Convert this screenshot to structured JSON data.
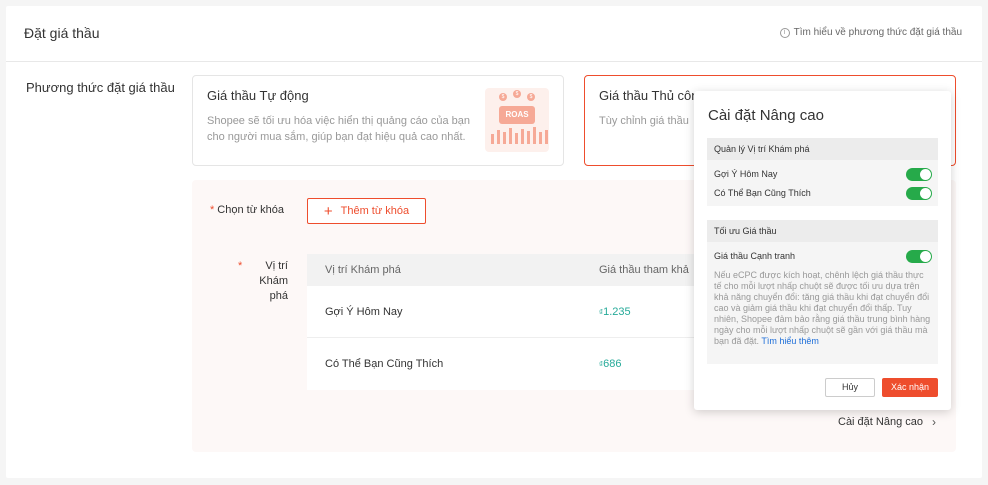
{
  "header": {
    "title": "Đặt giá thầu",
    "learn_link": "Tìm hiểu về phương thức đặt giá thầu"
  },
  "bid_method": {
    "label": "Phương thức đặt giá thầu",
    "auto": {
      "title": "Giá thầu Tự động",
      "desc": "Shopee sẽ tối ưu hóa việc hiển thị quảng cáo của bạn cho người mua sắm, giúp bạn đạt hiệu quả cao nhất.",
      "badge": "ROAS",
      "coin_symbol": "$"
    },
    "manual": {
      "title": "Giá thầu Thủ công",
      "desc": "Tùy chỉnh giá thầu"
    }
  },
  "keywords": {
    "label": "Chọn từ khóa",
    "required_mark": "*",
    "add_button": "Thêm từ khóa",
    "plus_glyph": "+"
  },
  "placement": {
    "label": "Vị trí Khám phá",
    "required_mark": "*",
    "columns": [
      "Vị trí Khám phá",
      "Giá thầu tham khả"
    ],
    "rows": [
      {
        "name": "Gợi Ý Hôm Nay",
        "currency": "₫",
        "bid": "1.235"
      },
      {
        "name": "Có Thể Bạn Cũng Thích",
        "currency": "₫",
        "bid": "686"
      }
    ]
  },
  "advanced_link": "Cài đặt Nâng cao",
  "popover": {
    "title": "Cài đặt Nâng cao",
    "section1": {
      "title": "Quản lý Vị trí Khám phá",
      "options": [
        {
          "label": "Gợi Ý Hôm Nay",
          "enabled": true
        },
        {
          "label": "Có Thể Bạn Cũng Thích",
          "enabled": true
        }
      ]
    },
    "section2": {
      "title": "Tối ưu Giá thầu",
      "option": {
        "label": "Giá thầu Cạnh tranh",
        "enabled": true
      },
      "desc": "Nếu eCPC được kích hoạt, chênh lệch giá thầu thực tế cho mỗi lượt nhấp chuột sẽ được tối ưu dựa trên khả năng chuyển đổi: tăng giá thầu khi đạt chuyển đổi cao và giảm giá thầu khi đạt chuyển đổi thấp. Tuy nhiên, Shopee đảm bảo rằng giá thầu trung bình hàng ngày cho mỗi lượt nhấp chuột sẽ gần với giá thầu mà bạn đã đặt. ",
      "desc_link": "Tìm hiểu thêm"
    },
    "cancel": "Hủy",
    "confirm": "Xác nhận"
  },
  "colors": {
    "accent": "#ee4d2d",
    "toggle_on": "#26aa4a",
    "bid_value": "#26aa99"
  },
  "icons": {
    "info": "info-icon",
    "plus": "plus-icon",
    "chevron": "chevron-right-icon"
  }
}
